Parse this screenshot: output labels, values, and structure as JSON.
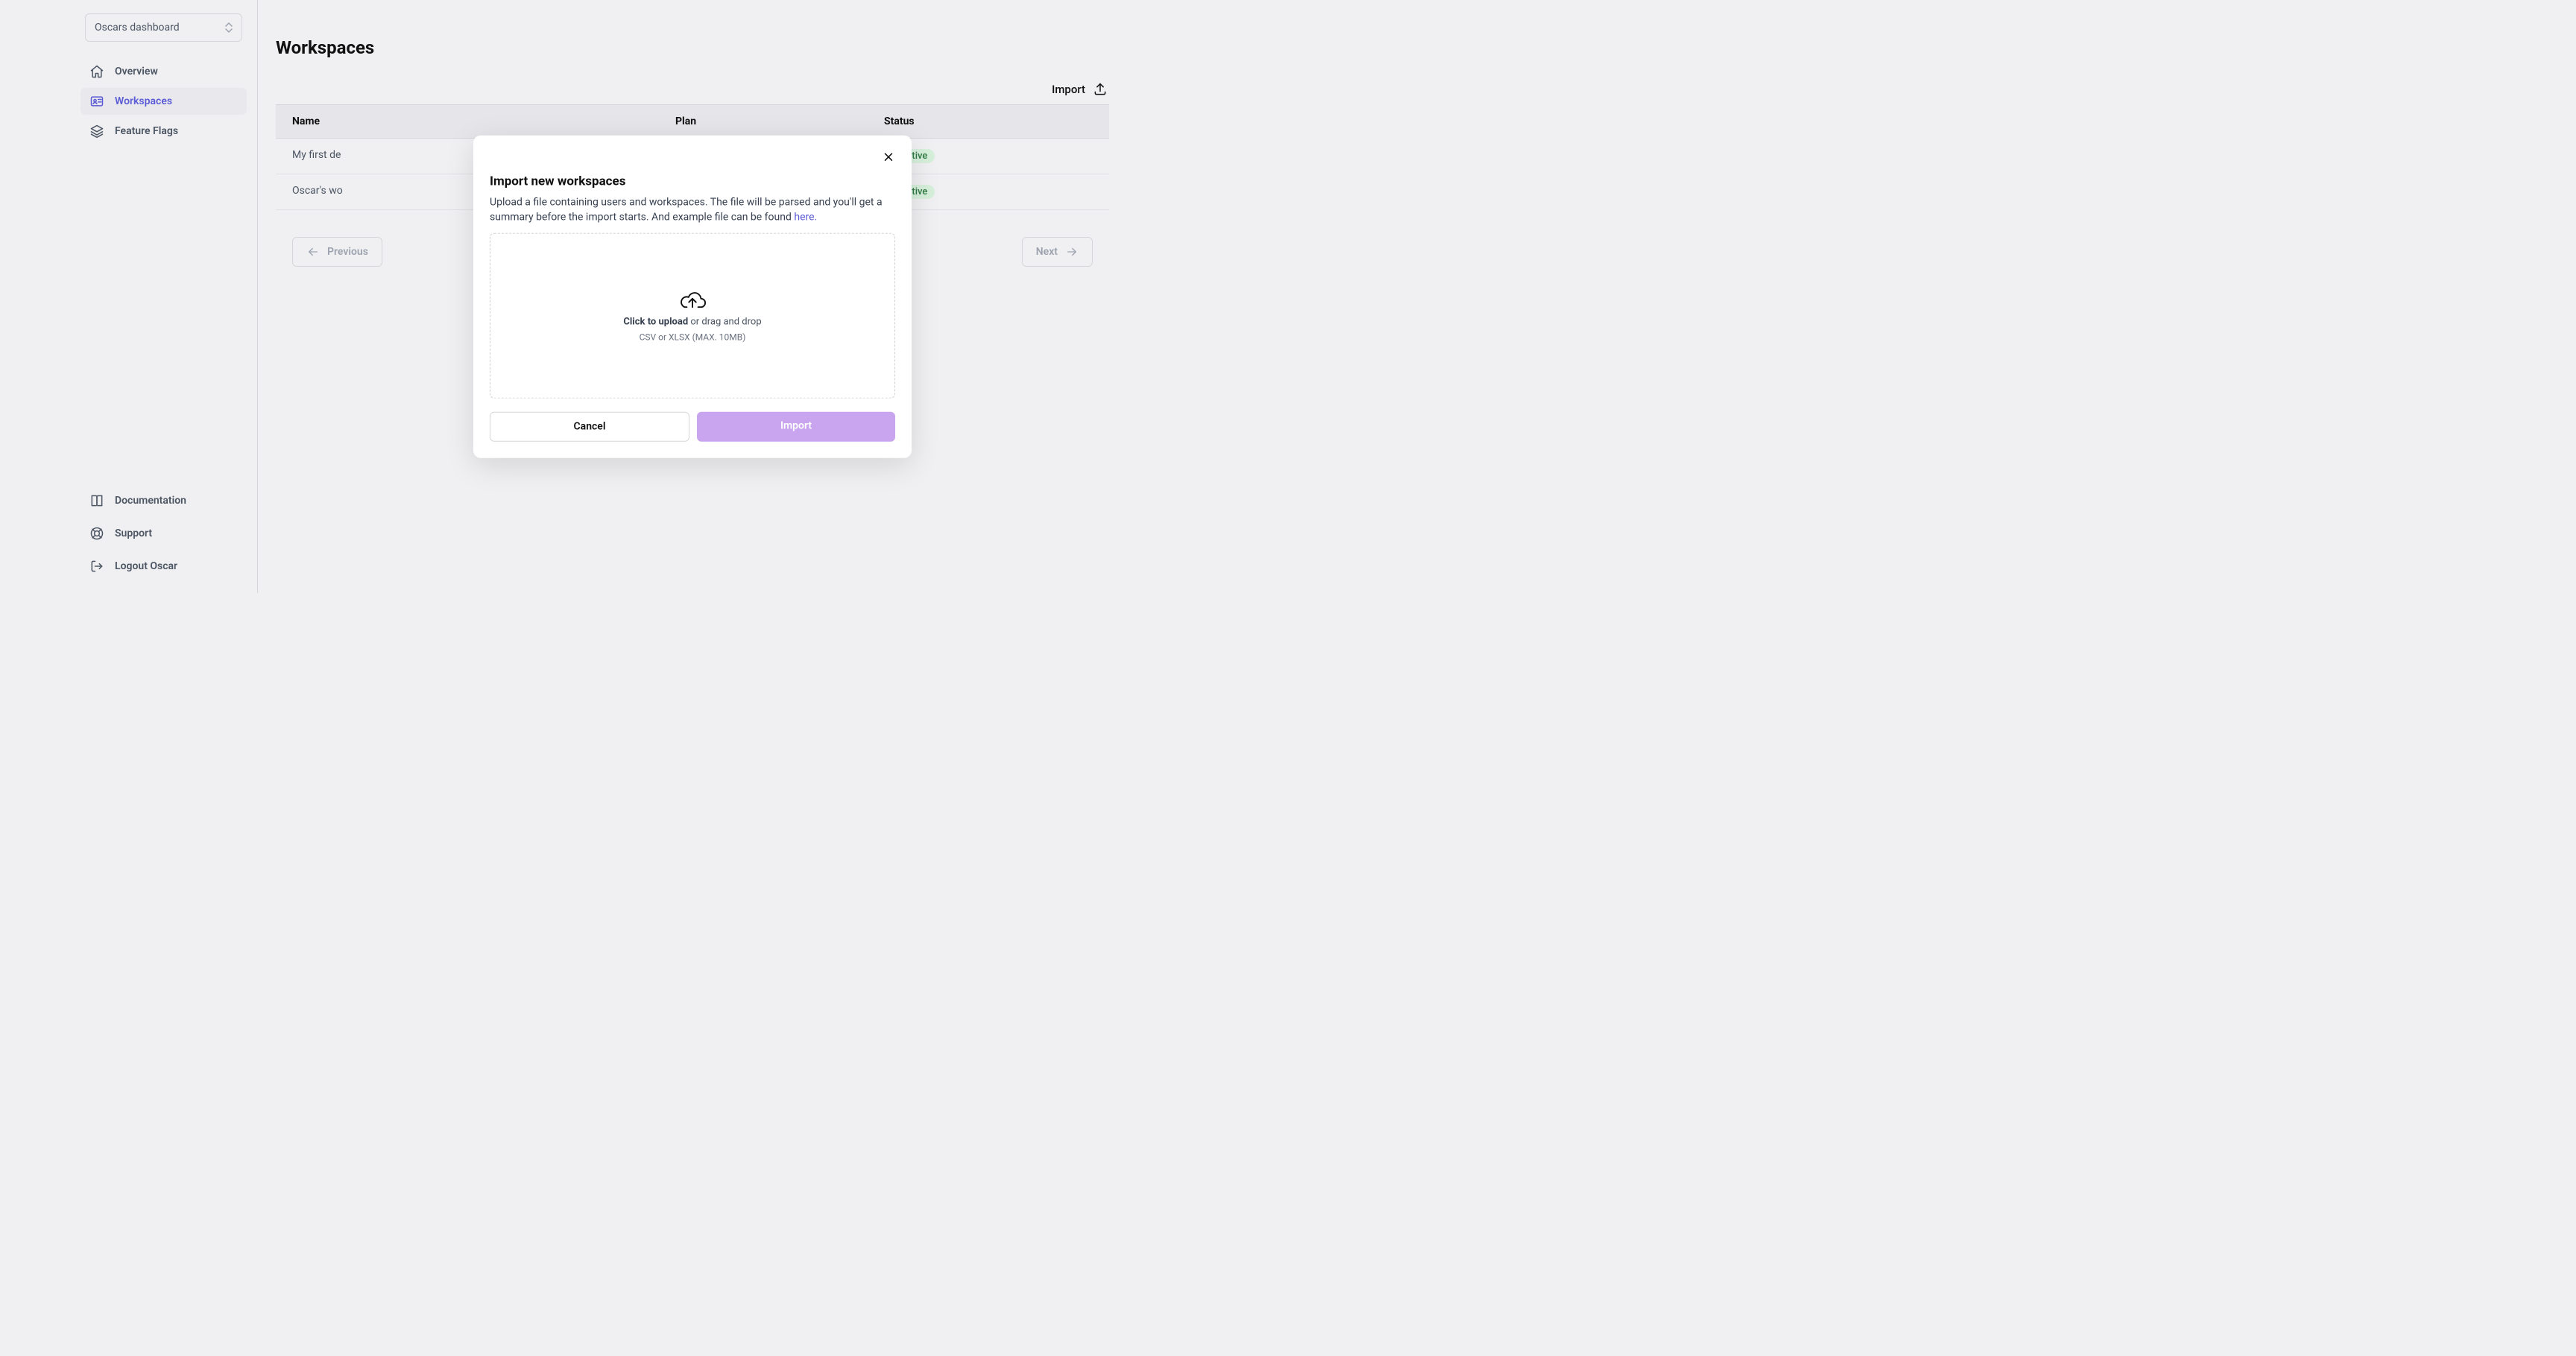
{
  "sidebar": {
    "account_label": "Oscars dashboard",
    "items": [
      {
        "label": "Overview"
      },
      {
        "label": "Workspaces"
      },
      {
        "label": "Feature Flags"
      }
    ],
    "bottom": [
      {
        "label": "Documentation"
      },
      {
        "label": "Support"
      },
      {
        "label": "Logout Oscar"
      }
    ]
  },
  "main": {
    "title": "Workspaces",
    "import_label": "Import",
    "columns": {
      "name": "Name",
      "plan": "Plan",
      "status": "Status"
    },
    "rows": [
      {
        "name": "My first de",
        "status": "Active"
      },
      {
        "name": "Oscar's wo",
        "status": "Active"
      }
    ],
    "pager": {
      "prev": "Previous",
      "next": "Next"
    }
  },
  "modal": {
    "title": "Import new workspaces",
    "description_part1": "Upload a file containing users and workspaces. The file will be parsed and you'll get a summary before the import starts. And example file can be found ",
    "here_link": "here.",
    "upload_bold": "Click to upload",
    "upload_rest": " or drag and drop",
    "constraints": "CSV or XLSX (MAX. 10MB)",
    "cancel": "Cancel",
    "import": "Import"
  }
}
